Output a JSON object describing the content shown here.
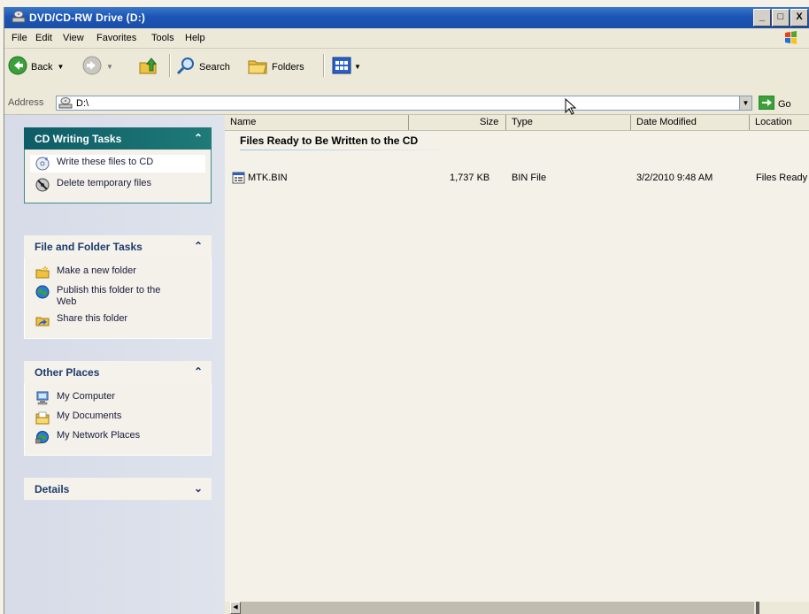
{
  "window": {
    "title": "DVD/CD-RW Drive (D:)",
    "buttons": {
      "minimize": "_",
      "maximize": "□",
      "close": "X"
    }
  },
  "menubar": {
    "items": [
      "File",
      "Edit",
      "View",
      "Favorites",
      "Tools",
      "Help"
    ]
  },
  "toolbar": {
    "back_label": "Back",
    "search_label": "Search",
    "folders_label": "Folders"
  },
  "addressbar": {
    "label": "Address",
    "value": "D:\\",
    "go_label": "Go"
  },
  "taskpane": {
    "panels": [
      {
        "title": "CD Writing Tasks",
        "items": [
          "Write these files to CD",
          "Delete temporary files"
        ]
      },
      {
        "title": "File and Folder Tasks",
        "items": [
          "Make a new folder",
          "Publish this folder to the Web",
          "Share this folder"
        ]
      },
      {
        "title": "Other Places",
        "items": [
          "My Computer",
          "My Documents",
          "My Network Places"
        ]
      },
      {
        "title": "Details",
        "items": []
      }
    ]
  },
  "filelist": {
    "columns": [
      "Name",
      "Size",
      "Type",
      "Date Modified",
      "Location"
    ],
    "group_title": "Files Ready to Be Written to the CD",
    "rows": [
      {
        "name": "MTK.BIN",
        "size": "1,737 KB",
        "type": "BIN File",
        "date": "3/2/2010 9:48 AM",
        "location": "Files Ready"
      }
    ]
  },
  "colors": {
    "title_bar": "#1c55b6",
    "task_header_special": "#0e5c66",
    "task_link": "#1b1b3a"
  }
}
